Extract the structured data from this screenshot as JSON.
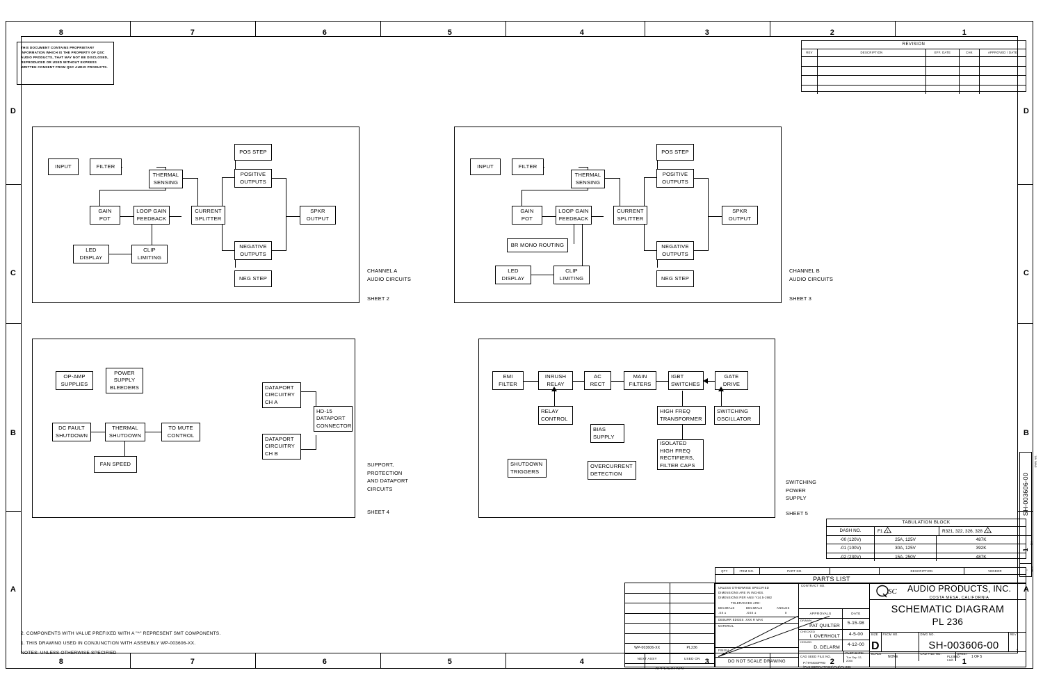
{
  "document": {
    "proprietary_note": "THIS DOCUMENT CONTAINS PROPRIETARY INFORMATION WHICH IS THE PROPERTY OF QSC AUDIO PRODUCTS, THAT MAY NOT BE DISCLOSED, REPRODUCED OR USED WITHOUT EXPRESS WRITTEN CONSENT FROM QSC AUDIO PRODUCTS.",
    "zone_columns": [
      "8",
      "7",
      "6",
      "5",
      "4",
      "3",
      "2",
      "1"
    ],
    "zone_rows": [
      "D",
      "C",
      "B",
      "A"
    ]
  },
  "revision": {
    "title": "REVISION",
    "headers": [
      "REV",
      "DESCRIPTION",
      "EFF. DATE",
      "CHK",
      "APPROVED / DATE"
    ],
    "rows": [
      [],
      [],
      [],
      []
    ]
  },
  "panels": {
    "channel_a": {
      "caption_line1": "CHANNEL A",
      "caption_line2": "AUDIO CIRCUITS",
      "sheet": "SHEET 2",
      "blocks": {
        "input": "INPUT",
        "filter": "FILTER",
        "thermal_sensing": "THERMAL\nSENSING",
        "pos_step": "POS STEP",
        "positive_outputs": "POSITIVE\nOUTPUTS",
        "gain_pot": "GAIN\nPOT",
        "loop_gain_feedback": "LOOP GAIN\nFEEDBACK",
        "current_splitter": "CURRENT\nSPLITTER",
        "spkr_output": "SPKR\nOUTPUT",
        "led_display": "LED\nDISPLAY",
        "clip_limiting": "CLIP\nLIMITING",
        "negative_outputs": "NEGATIVE\nOUTPUTS",
        "neg_step": "NEG STEP"
      }
    },
    "channel_b": {
      "caption_line1": "CHANNEL B",
      "caption_line2": "AUDIO CIRCUITS",
      "sheet": "SHEET 3",
      "blocks": {
        "input": "INPUT",
        "filter": "FILTER",
        "thermal_sensing": "THERMAL\nSENSING",
        "pos_step": "POS STEP",
        "positive_outputs": "POSITIVE\nOUTPUTS",
        "gain_pot": "GAIN\nPOT",
        "loop_gain_feedback": "LOOP GAIN\nFEEDBACK",
        "current_splitter": "CURRENT\nSPLITTER",
        "spkr_output": "SPKR\nOUTPUT",
        "br_mono_routing": "BR MONO ROUTING",
        "led_display": "LED\nDISPLAY",
        "clip_limiting": "CLIP\nLIMITING",
        "negative_outputs": "NEGATIVE\nOUTPUTS",
        "neg_step": "NEG STEP"
      }
    },
    "support": {
      "caption_line1": "SUPPORT,",
      "caption_line2": "PROTECTION",
      "caption_line3": "AND DATAPORT",
      "caption_line4": "CIRCUITS",
      "sheet": "SHEET 4",
      "blocks": {
        "op_amp_supplies": "OP-AMP\nSUPPLIES",
        "power_supply_bleeders": "POWER\nSUPPLY\nBLEEDERS",
        "dataport_ch_a": "DATAPORT\nCIRCUITRY\nCH A",
        "hd15_connector": "HD-15\nDATAPORT\nCONNECTOR",
        "dataport_ch_b": "DATAPORT\nCIRCUITRY\nCH B",
        "dc_fault_shutdown": "DC FAULT\nSHUTDOWN",
        "thermal_shutdown": "THERMAL\nSHUTDOWN",
        "to_mute_control": "TO MUTE\nCONTROL",
        "fan_speed": "FAN SPEED"
      }
    },
    "psu": {
      "caption_line1": "SWITCHING",
      "caption_line2": "POWER",
      "caption_line3": "SUPPLY",
      "sheet": "SHEET 5",
      "blocks": {
        "emi_filter": "EMI\nFILTER",
        "inrush_relay": "INRUSH\nRELAY",
        "ac_rect": "AC\nRECT",
        "main_filters": "MAIN\nFILTERS",
        "igbt_switches": "IGBT\nSWITCHES",
        "gate_drive": "GATE\nDRIVE",
        "relay_control": "RELAY\nCONTROL",
        "high_freq_transformer": "HIGH FREQ\nTRANSFORMER",
        "switching_oscillator": "SWITCHING\nOSCILLATOR",
        "bias_supply": "BIAS\nSUPPLY",
        "isolated_rectifiers": "ISOLATED\nHIGH FREQ\nRECTIFIERS,\nFILTER CAPS",
        "shutdown_triggers": "SHUTDOWN\nTRIGGERS",
        "overcurrent_detection": "OVERCURRENT\nDETECTION"
      }
    }
  },
  "tabulation": {
    "title": "TABULATION BLOCK",
    "headers": [
      "DASH NO.",
      "F1",
      "R321, 322, 326, 328"
    ],
    "header_flags": [
      "1",
      "2"
    ],
    "rows": [
      {
        "dash": "-00 (120V)",
        "f1": "25A, 125V",
        "r321": "487K"
      },
      {
        "dash": "-01 (100V)",
        "f1": "30A, 125V",
        "r321": "392K"
      },
      {
        "dash": "-02 (230V)",
        "f1": "15A, 250V",
        "r321": "487K"
      }
    ]
  },
  "parts_list": {
    "headers": [
      "QTY",
      "ITEM NO.",
      "PART NO.",
      "",
      "DESCRIPTION",
      "VENDOR"
    ],
    "title": "PARTS LIST"
  },
  "application": {
    "next_assy_value": "WP-003606-XX",
    "used_on_value": "PL236",
    "next_assy_label": "NEXT ASSY",
    "used_on_label": "USED ON",
    "footer": "APPLICATION"
  },
  "title_block": {
    "tolerance_lines": [
      "UNLESS OTHERWISE SPECIFIED",
      "DIMENSIONS ARE IN INCHES.",
      "DIMENSIONS PER ANSI Y14.5-1982",
      "TOLERANCES ARE:"
    ],
    "tol_col1_head": "DECIMALS",
    "tol_col1_val": ".XX  ±",
    "tol_col2_head": "DECIMALS",
    "tol_col2_val": ".XXX  ±",
    "tol_col3_head": "ANGLES",
    "tol_col3_val": "0",
    "deburr": "DEBURR EDGES .XXX R MAX",
    "material_label": "MATERIAL",
    "finish_label": "FINISH",
    "do_not_scale": "DO NOT SCALE DRAWING",
    "contract_label": "CONTRACT NO.",
    "approvals_label": "APPROVALS",
    "date_label": "DATE",
    "drawn_label": "DRAWN",
    "drawn_name": "PAT QUILTER",
    "drawn_date": "5-15-98",
    "checked_label": "CHECKED",
    "checked_name": "I. OVERHOLT",
    "checked_date": "4-5-00",
    "issued_label": "ISSUED",
    "issued_name": "D. DELARM",
    "issued_date": "4-12-00",
    "cad_seed_label": "CAD SEED FILE NO.",
    "plot_date_label": "PLOT DATE:",
    "plot_date_value": "Tue Sep 12, 2000",
    "company_name": "AUDIO PRODUCTS, INC.",
    "company_city": "COSTA MESA, CALIFORNIA",
    "logo_text": "QSC",
    "drawing_title": "SCHEMATIC DIAGRAM",
    "drawing_subtitle": "PL 236",
    "size_label": "SIZE",
    "size_value": "D",
    "fscm_label": "FSCM NO.",
    "fscm_value": "",
    "dwg_label": "DWG NO.",
    "dwg_value": "SH-003606-00",
    "rev_label": "REV",
    "rev_value": ".",
    "scale_label": "SCALE",
    "scale_value": "NONE",
    "cad_file_label": "CAD FILE NO.",
    "cad_file_value": "PL236SD-I.sch",
    "sheet_label": "SHEET",
    "sheet_value": "1  OF  5",
    "file_path_line1": "P:\\TANGOPRO",
    "file_path_line2": "\\PLC DERIVATIVES\\PL2\\PL 236"
  },
  "notes": {
    "line_2": "2. COMPONENTS WITH VALUE PREFIXED WITH A \"^\" REPRESENT SMT COMPONENTS.",
    "line_1": "1. THIS DRAWING USED IN CONJUNCTION WITH ASSEMBLY WP-003606-XX.",
    "line_0": "NOTES: UNLESS OTHERWISE SPECIFIED"
  },
  "edge_strip": {
    "dwg_no_label": "DWG NO.",
    "dwg_no_value": "SH-003606-00",
    "sheet_label": "SH",
    "sheet_value": "1",
    "rev_label": "REV",
    "rev_value": "."
  }
}
